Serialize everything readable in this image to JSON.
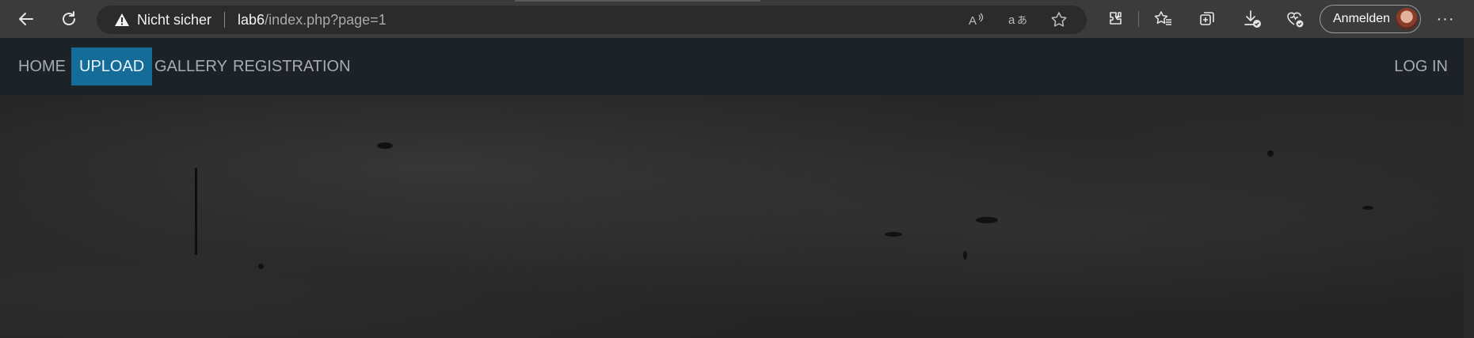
{
  "browser": {
    "back_icon": "arrow-left-icon",
    "reload_icon": "reload-icon",
    "security_label": "Nicht sicher",
    "url_host": "lab6",
    "url_path": "/index.php?page=1",
    "omnibox_icons": [
      "read-aloud-icon",
      "translate-icon",
      "favorite-star-icon"
    ],
    "toolbar_icons": [
      "extensions-icon",
      "favorites-icon",
      "collections-icon",
      "downloads-icon",
      "browser-essentials-icon"
    ],
    "profile_label": "Anmelden",
    "more_label": "···"
  },
  "site": {
    "nav": [
      {
        "label": "HOME"
      },
      {
        "label": "UPLOAD",
        "active": true
      },
      {
        "label": "GALLERY"
      },
      {
        "label": "REGISTRATION"
      }
    ],
    "login_label": "LOG IN",
    "active_color": "#156c99",
    "navbar_color": "#1d2226"
  }
}
